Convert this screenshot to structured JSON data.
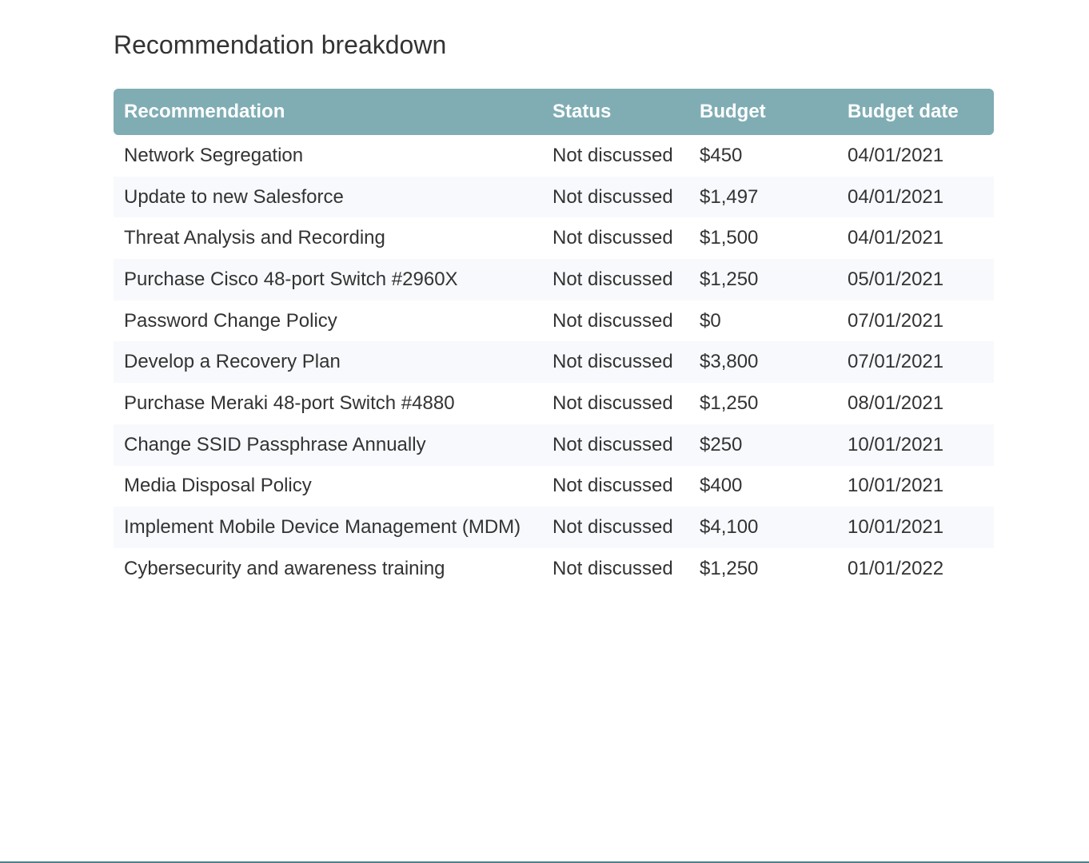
{
  "page": {
    "title": "Recommendation breakdown"
  },
  "table": {
    "headers": {
      "recommendation": "Recommendation",
      "status": "Status",
      "budget": "Budget",
      "budget_date": "Budget date"
    },
    "rows": [
      {
        "recommendation": "Network Segregation",
        "status": "Not discussed",
        "budget": "$450",
        "budget_date": "04/01/2021"
      },
      {
        "recommendation": "Update to new Salesforce",
        "status": "Not discussed",
        "budget": "$1,497",
        "budget_date": "04/01/2021"
      },
      {
        "recommendation": "Threat Analysis and Recording",
        "status": "Not discussed",
        "budget": "$1,500",
        "budget_date": "04/01/2021"
      },
      {
        "recommendation": "Purchase Cisco 48-port Switch #2960X",
        "status": "Not discussed",
        "budget": "$1,250",
        "budget_date": "05/01/2021"
      },
      {
        "recommendation": "Password Change Policy",
        "status": "Not discussed",
        "budget": "$0",
        "budget_date": "07/01/2021"
      },
      {
        "recommendation": "Develop a Recovery Plan",
        "status": "Not discussed",
        "budget": "$3,800",
        "budget_date": "07/01/2021"
      },
      {
        "recommendation": "Purchase Meraki 48-port Switch #4880",
        "status": "Not discussed",
        "budget": "$1,250",
        "budget_date": "08/01/2021"
      },
      {
        "recommendation": "Change SSID Passphrase Annually",
        "status": "Not discussed",
        "budget": "$250",
        "budget_date": "10/01/2021"
      },
      {
        "recommendation": "Media Disposal Policy",
        "status": "Not discussed",
        "budget": "$400",
        "budget_date": "10/01/2021"
      },
      {
        "recommendation": "Implement Mobile Device Management (MDM)",
        "status": "Not discussed",
        "budget": "$4,100",
        "budget_date": "10/01/2021"
      },
      {
        "recommendation": "Cybersecurity and awareness training",
        "status": "Not discussed",
        "budget": "$1,250",
        "budget_date": "01/01/2022"
      }
    ]
  },
  "colors": {
    "header_background": "#80adb4",
    "header_text": "#ffffff",
    "stripe_background": "#f7f9fc",
    "body_text": "#333333",
    "bottom_rule": "#4d8288"
  }
}
